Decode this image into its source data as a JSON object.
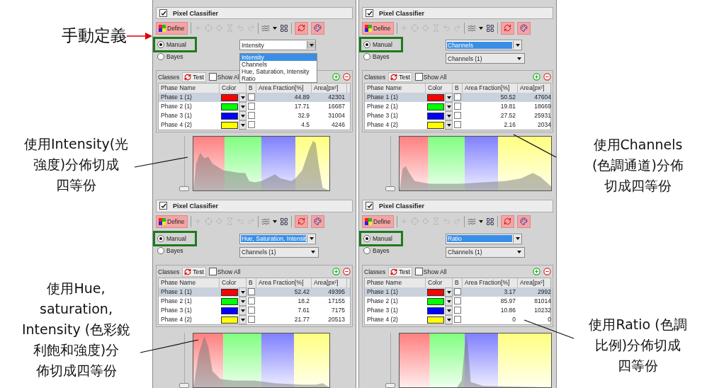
{
  "left_notes": [
    {
      "kind": "arrow",
      "text": "手動定義"
    },
    {
      "kind": "leader",
      "lines": [
        "使用Intensity(光",
        "強度)分佈切成",
        "四等份"
      ]
    },
    {
      "kind": "leader",
      "lines": [
        "使用Hue,",
        "saturation,",
        "Intensity (色彩銳",
        "利飽和強度)分",
        "佈切成四等份"
      ]
    }
  ],
  "panels": [
    {
      "title": "Pixel Classifier",
      "enabled": true,
      "define_label": "Define",
      "modes": [
        {
          "label": "Manual",
          "selected": true,
          "outlined": true
        },
        {
          "label": "Bayes",
          "selected": false,
          "outlined": false
        }
      ],
      "dropdowns": [
        {
          "kind": "combo",
          "value": "Intensity",
          "highlighted": false,
          "open": true,
          "options": [
            {
              "label": "Intensity",
              "selected": true
            },
            {
              "label": "Channels",
              "selected": false
            },
            {
              "label": "Hue, Saturation, Intensity",
              "selected": false
            },
            {
              "label": "Ratio",
              "selected": false
            }
          ]
        }
      ],
      "classes_label": "Classes",
      "test_label": "Test",
      "show_all": {
        "label": "Show Al",
        "checked": false
      },
      "columns": [
        "Phase Name",
        "Color",
        "B",
        "Area Fraction[%]",
        "Area[px²]"
      ],
      "rows": [
        {
          "name": "Phase 1 (1)",
          "color": "#ff0000",
          "b": false,
          "fraction": "44.89",
          "area": "42301",
          "selected": true
        },
        {
          "name": "Phase 2 (1)",
          "color": "#00ff00",
          "b": false,
          "fraction": "17.71",
          "area": "16687",
          "selected": false
        },
        {
          "name": "Phase 3 (1)",
          "color": "#0000ff",
          "b": false,
          "fraction": "32.9",
          "area": "31004",
          "selected": false
        },
        {
          "name": "Phase 4 (2)",
          "color": "#ffff00",
          "b": false,
          "fraction": "4.5",
          "area": "4246",
          "selected": false
        }
      ],
      "slider": {
        "level": 0
      }
    },
    {
      "title": "Pixel Classifier",
      "enabled": true,
      "define_label": "Define",
      "modes": [
        {
          "label": "Manual",
          "selected": true,
          "outlined": true
        },
        {
          "label": "Bayes",
          "selected": false,
          "outlined": false
        }
      ],
      "dropdowns": [
        {
          "kind": "combo",
          "value": "Channels",
          "highlighted": true
        },
        {
          "kind": "select",
          "value": "Channels (1)"
        }
      ],
      "classes_label": "Classes",
      "test_label": "Test",
      "show_all": {
        "label": "Show All",
        "checked": false
      },
      "columns": [
        "Phase Name",
        "Color",
        "B",
        "Area Fraction[%]",
        "Area[px²]"
      ],
      "rows": [
        {
          "name": "Phase 1 (1)",
          "color": "#ff0000",
          "b": false,
          "fraction": "50.52",
          "area": "47604",
          "selected": true
        },
        {
          "name": "Phase 2 (1)",
          "color": "#00ff00",
          "b": false,
          "fraction": "19.81",
          "area": "18669",
          "selected": false
        },
        {
          "name": "Phase 3 (1)",
          "color": "#0000ff",
          "b": false,
          "fraction": "27.52",
          "area": "25931",
          "selected": false
        },
        {
          "name": "Phase 4 (2)",
          "color": "#ffff00",
          "b": false,
          "fraction": "2.16",
          "area": "2034",
          "selected": false
        }
      ],
      "slider": {
        "level": 0
      }
    },
    {
      "title": "Pixel Classifier",
      "enabled": true,
      "define_label": "Define",
      "modes": [
        {
          "label": "Manual",
          "selected": true,
          "outlined": true
        },
        {
          "label": "Bayes",
          "selected": false,
          "outlined": false
        }
      ],
      "dropdowns": [
        {
          "kind": "combo",
          "value": "Hue, Saturation, Intensit",
          "highlighted": true
        },
        {
          "kind": "select",
          "value": "Channels (1)"
        }
      ],
      "classes_label": "Classes",
      "test_label": "Test",
      "show_all": {
        "label": "Show All",
        "checked": false
      },
      "columns": [
        "Phase Name",
        "Color",
        "B",
        "Area Fraction[%]",
        "Area[px²]"
      ],
      "rows": [
        {
          "name": "Phase 1 (1)",
          "color": "#ff0000",
          "b": false,
          "fraction": "52.42",
          "area": "49395",
          "selected": true
        },
        {
          "name": "Phase 2 (1)",
          "color": "#00ff00",
          "b": false,
          "fraction": "18.2",
          "area": "17155",
          "selected": false
        },
        {
          "name": "Phase 3 (1)",
          "color": "#0000ff",
          "b": false,
          "fraction": "7.61",
          "area": "7175",
          "selected": false
        },
        {
          "name": "Phase 4 (2)",
          "color": "#ffff00",
          "b": false,
          "fraction": "21.77",
          "area": "20513",
          "selected": false
        }
      ],
      "slider": {
        "level": 0
      }
    },
    {
      "title": "Pixel Classifier",
      "enabled": true,
      "define_label": "Define",
      "modes": [
        {
          "label": "Manual",
          "selected": true,
          "outlined": true
        },
        {
          "label": "Bayes",
          "selected": false,
          "outlined": false
        }
      ],
      "dropdowns": [
        {
          "kind": "combo",
          "value": "Ratio",
          "highlighted": true
        },
        {
          "kind": "select",
          "value": "Channels (1)"
        }
      ],
      "classes_label": "Classes",
      "test_label": "Test",
      "show_all": {
        "label": "Show All",
        "checked": false
      },
      "columns": [
        "Phase Name",
        "Color",
        "B",
        "Area Fraction[%]",
        "Area[px²]"
      ],
      "rows": [
        {
          "name": "Phase 1 (1)",
          "color": "#ff0000",
          "b": false,
          "fraction": "3.17",
          "area": "2992",
          "selected": true
        },
        {
          "name": "Phase 2 (1)",
          "color": "#00ff00",
          "b": false,
          "fraction": "85.97",
          "area": "81014",
          "selected": false
        },
        {
          "name": "Phase 3 (1)",
          "color": "#0000ff",
          "b": false,
          "fraction": "10.86",
          "area": "10232",
          "selected": false
        },
        {
          "name": "Phase 4 (2)",
          "color": "#ffff00",
          "b": false,
          "fraction": "0",
          "area": "0",
          "selected": false
        }
      ],
      "slider": {
        "level": 0
      }
    }
  ],
  "right_notes": [
    {
      "kind": "leader",
      "lines": [
        "使用Channels",
        "(色調通道)分佈",
        "切成四等份"
      ]
    },
    {
      "kind": "leader",
      "lines": [
        "使用Ratio (色調",
        "比例)分佈切成",
        "四等份"
      ]
    }
  ]
}
